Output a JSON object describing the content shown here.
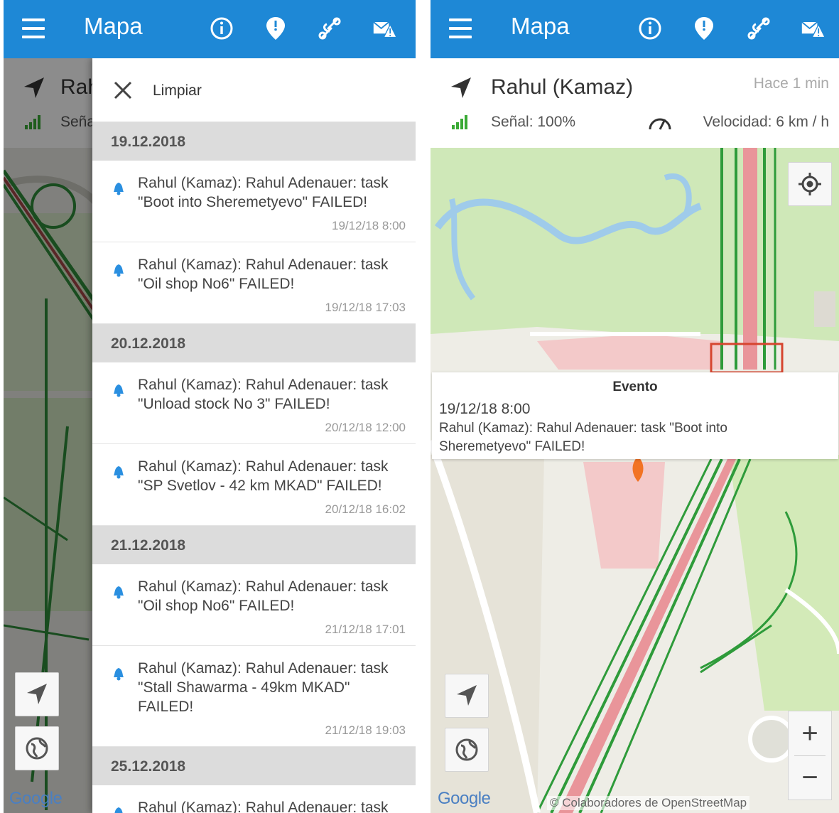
{
  "app": {
    "title": "Mapa",
    "accent_color": "#1e88d6",
    "header_icons": [
      "menu-icon",
      "info-icon",
      "pin-alert-icon",
      "route-icon",
      "mail-alert-icon"
    ]
  },
  "vehicle": {
    "name": "Rahul (Kamaz)",
    "name_truncated": "Rah",
    "signal_truncated": "Seña",
    "last_update": "Hace 1 min",
    "signal": "Señal: 100%",
    "speed": "Velocidad: 6 km / h"
  },
  "drawer": {
    "clear_label": "Limpiar",
    "groups": [
      {
        "date": "19.12.2018",
        "items": [
          {
            "text": "Rahul (Kamaz): Rahul Adenauer:  task \"Boot into Sheremetyevo\" FAILED!",
            "time": "19/12/18 8:00"
          },
          {
            "text": "Rahul (Kamaz): Rahul Adenauer:  task \"Oil shop No6\" FAILED!",
            "time": "19/12/18 17:03"
          }
        ]
      },
      {
        "date": "20.12.2018",
        "items": [
          {
            "text": "Rahul (Kamaz): Rahul Adenauer:  task \"Unload stock No 3\" FAILED!",
            "time": "20/12/18 12:00"
          },
          {
            "text": "Rahul (Kamaz): Rahul Adenauer:  task \"SP Svetlov - 42 km MKAD\" FAILED!",
            "time": "20/12/18 16:02"
          }
        ]
      },
      {
        "date": "21.12.2018",
        "items": [
          {
            "text": "Rahul (Kamaz): Rahul Adenauer:  task \"Oil shop No6\" FAILED!",
            "time": "21/12/18 17:01"
          },
          {
            "text": "Rahul (Kamaz): Rahul Adenauer:  task \"Stall Shawarma - 49km MKAD\" FAILED!",
            "time": "21/12/18 19:03"
          }
        ]
      },
      {
        "date": "25.12.2018",
        "items": [
          {
            "text": "Rahul (Kamaz): Rahul Adenauer:  task",
            "time": ""
          }
        ]
      }
    ]
  },
  "event": {
    "title": "Evento",
    "time": "19/12/18 8:00",
    "message": "Rahul (Kamaz): Rahul Adenauer:  task \"Boot into Sheremetyevo\" FAILED!"
  },
  "map": {
    "google_label": "Google",
    "attribution": "© Colaboradores de OpenStreetMap",
    "zoom_in": "+",
    "zoom_out": "−"
  }
}
